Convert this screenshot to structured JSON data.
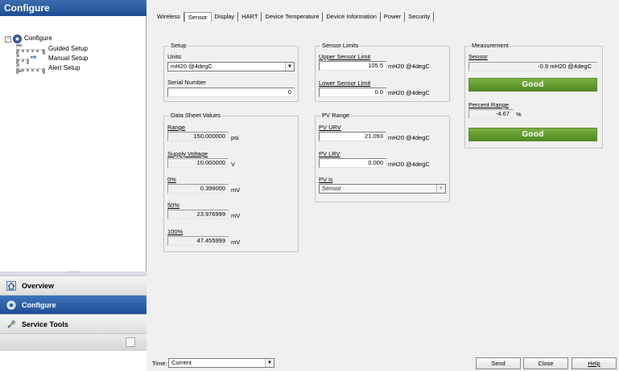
{
  "nav": {
    "title": "Configure",
    "tree": {
      "root": "Configure",
      "children": [
        "Guided Setup",
        "Manual Setup",
        "Alert Setup"
      ],
      "selected": "Manual Setup"
    },
    "splitter_grip": "··········",
    "buttons": [
      {
        "label": "Overview",
        "icon": "home-icon",
        "active": false
      },
      {
        "label": "Configure",
        "icon": "gear-icon",
        "active": true
      },
      {
        "label": "Service Tools",
        "icon": "tools-icon",
        "active": false
      }
    ]
  },
  "tabs": [
    "Wireless",
    "Sensor",
    "Display",
    "HART",
    "Device Temperature",
    "Device Information",
    "Power",
    "Security"
  ],
  "active_tab": "Sensor",
  "setup": {
    "title": "Setup",
    "units_label": "Units",
    "units_value": "mH20 @4degC",
    "serial_label": "Serial Number",
    "serial_value": "0"
  },
  "sensor_limits": {
    "title": "Sensor Limits",
    "usl_label": "Upper Sensor Limit",
    "usl_value": "105.5",
    "usl_unit": "mH20 @4degC",
    "lsl_label": "Lower Sensor Limit",
    "lsl_value": "0.0",
    "lsl_unit": "mH20 @4degC"
  },
  "measurement": {
    "title": "Measurement",
    "sensor_label": "Sensor",
    "sensor_value": "-0.9 mH20 @4degC",
    "sensor_status": "Good",
    "percent_label": "Percent Range",
    "percent_value": "-4.67",
    "percent_unit": "%",
    "percent_status": "Good",
    "status_color": "#5e9a2c"
  },
  "data_sheet": {
    "title": "Data Sheet Values",
    "range_label": "Range",
    "range_value": "150.000000",
    "range_unit": "psi",
    "supply_label": "Supply Voltage",
    "supply_value": "10.000000",
    "supply_unit": "V",
    "p0_label": "0%",
    "p0_value": "0.399000",
    "p0_unit": "mV",
    "p50_label": "50%",
    "p50_value": "23.976999",
    "p50_unit": "mV",
    "p100_label": "100%",
    "p100_value": "47.455999",
    "p100_unit": "mV"
  },
  "pv_range": {
    "title": "PV Range",
    "urv_label": "PV URV",
    "urv_value": "21.093",
    "urv_unit": "mH20 @4degC",
    "lrv_label": "PV LRV",
    "lrv_value": "0.000",
    "lrv_unit": "mH20 @4degC",
    "pvis_label": "PV is",
    "pvis_value": "Sensor"
  },
  "bottom": {
    "time_label": "Time:",
    "time_value": "Current",
    "send": "Send",
    "close": "Close",
    "help": "Help"
  },
  "colors": {
    "header_blue": "#2a5aa0",
    "good_green": "#5e9a2c"
  }
}
